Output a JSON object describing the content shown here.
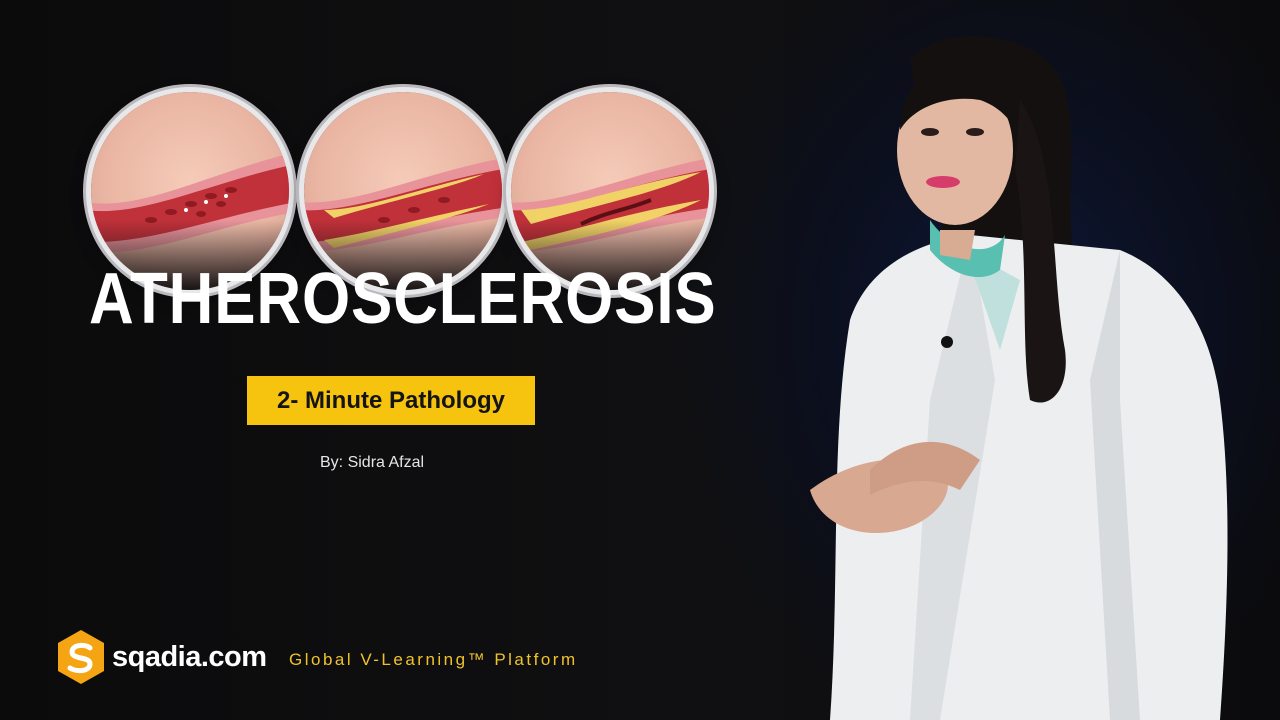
{
  "title": "ATHEROSCLEROSIS",
  "subtitle_badge": "2- Minute Pathology",
  "byline": "By: Sidra Afzal",
  "brand": {
    "logo_text": "sqadia.com",
    "tagline": "Global V-Learning™ Platform"
  },
  "artery_illustrations": [
    {
      "stage": "normal",
      "icon": "healthy-artery-icon"
    },
    {
      "stage": "plaque-buildup",
      "icon": "plaque-artery-icon"
    },
    {
      "stage": "narrowed",
      "icon": "narrowed-artery-icon"
    }
  ],
  "colors": {
    "background": "#0c0c0e",
    "accent_yellow": "#f6c40f",
    "tagline_gold": "#f0c22a",
    "logo_orange": "#f5a514",
    "artery_red": "#c0313a",
    "plaque_yellow": "#f1d267"
  }
}
